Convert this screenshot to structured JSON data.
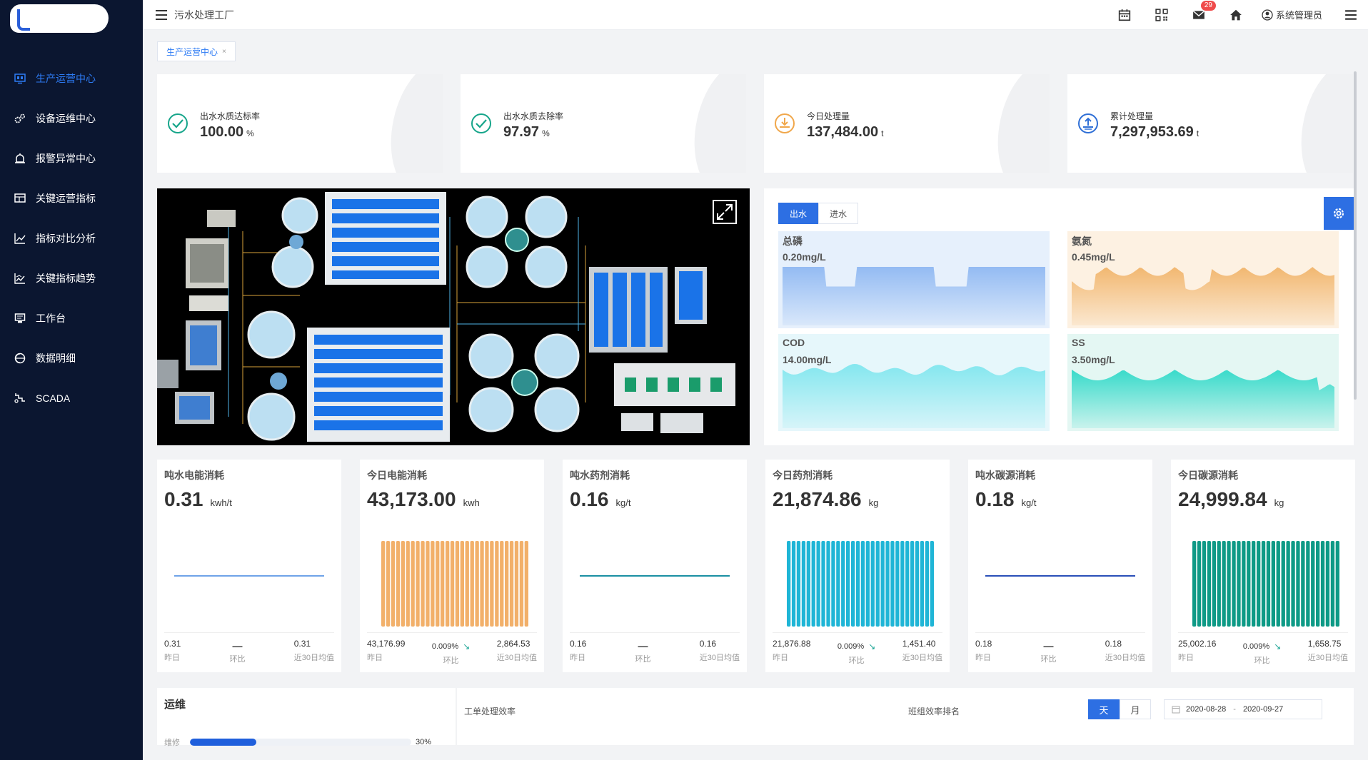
{
  "sidebar": {
    "items": [
      {
        "label": "生产运营中心",
        "icon": "monitor-icon",
        "active": true
      },
      {
        "label": "设备运维中心",
        "icon": "gears-icon",
        "active": false
      },
      {
        "label": "报警异常中心",
        "icon": "alarm-icon",
        "active": false
      },
      {
        "label": "关键运营指标",
        "icon": "dashboard-icon",
        "active": false
      },
      {
        "label": "指标对比分析",
        "icon": "line-chart-icon",
        "active": false
      },
      {
        "label": "关键指标趋势",
        "icon": "trend-icon",
        "active": false
      },
      {
        "label": "工作台",
        "icon": "desktop-icon",
        "active": false
      },
      {
        "label": "数据明细",
        "icon": "database-icon",
        "active": false
      },
      {
        "label": "SCADA",
        "icon": "scada-icon",
        "active": false
      }
    ]
  },
  "header": {
    "breadcrumb": "污水处理工厂",
    "mail_badge": "29",
    "user": "系统管理员"
  },
  "tags": {
    "active_tag": "生产运营中心",
    "close": "×"
  },
  "stats": [
    {
      "label": "出水水质达标率",
      "value": "100.00",
      "unit": "%",
      "icon": "check-circle-icon"
    },
    {
      "label": "出水水质去除率",
      "value": "97.97",
      "unit": "%",
      "icon": "check-circle-icon"
    },
    {
      "label": "今日处理量",
      "value": "137,484.00",
      "unit": "t",
      "icon": "download-circle-icon"
    },
    {
      "label": "累计处理量",
      "value": "7,297,953.69",
      "unit": "t",
      "icon": "upload-circle-icon"
    }
  ],
  "quality": {
    "tabs": [
      "出水",
      "进水"
    ],
    "active_tab": "出水",
    "cards": [
      {
        "name": "总磷",
        "value": "0.20mg/L",
        "color": "#8fb8f2",
        "bg": "#e6f0fc"
      },
      {
        "name": "氨氮",
        "value": "0.45mg/L",
        "color": "#f1b46a",
        "bg": "#fdf1e2"
      },
      {
        "name": "COD",
        "value": "14.00mg/L",
        "color": "#7fe6ee",
        "bg": "#e6f7fb"
      },
      {
        "name": "SS",
        "value": "3.50mg/L",
        "color": "#2fd9c8",
        "bg": "#e4f7f3"
      }
    ]
  },
  "consumption": [
    {
      "title": "吨水电能消耗",
      "value": "0.31",
      "unit": "kwh/t",
      "yesterday": "0.31",
      "yesterday_label": "昨日",
      "ratio": "—",
      "ratio_label": "环比",
      "avg": "0.31",
      "avg_label": "近30日均值",
      "chart": "line",
      "color": "#6fa3e8"
    },
    {
      "title": "今日电能消耗",
      "value": "43,173.00",
      "unit": "kwh",
      "yesterday": "43,176.99",
      "yesterday_label": "昨日",
      "ratio": "0.009%",
      "ratio_label": "环比",
      "avg": "2,864.53",
      "avg_label": "近30日均值",
      "chart": "bar",
      "color": "#f2b06a"
    },
    {
      "title": "吨水药剂消耗",
      "value": "0.16",
      "unit": "kg/t",
      "yesterday": "0.16",
      "yesterday_label": "昨日",
      "ratio": "—",
      "ratio_label": "环比",
      "avg": "0.16",
      "avg_label": "近30日均值",
      "chart": "line",
      "color": "#1a8fa3"
    },
    {
      "title": "今日药剂消耗",
      "value": "21,874.86",
      "unit": "kg",
      "yesterday": "21,876.88",
      "yesterday_label": "昨日",
      "ratio": "0.009%",
      "ratio_label": "环比",
      "avg": "1,451.40",
      "avg_label": "近30日均值",
      "chart": "bar",
      "color": "#1fb5d6"
    },
    {
      "title": "吨水碳源消耗",
      "value": "0.18",
      "unit": "kg/t",
      "yesterday": "0.18",
      "yesterday_label": "昨日",
      "ratio": "—",
      "ratio_label": "环比",
      "avg": "0.18",
      "avg_label": "近30日均值",
      "chart": "line",
      "color": "#2a4fb8"
    },
    {
      "title": "今日碳源消耗",
      "value": "24,999.84",
      "unit": "kg",
      "yesterday": "25,002.16",
      "yesterday_label": "昨日",
      "ratio": "0.009%",
      "ratio_label": "环比",
      "avg": "1,658.75",
      "avg_label": "近30日均值",
      "chart": "bar",
      "color": "#0e9a86"
    }
  ],
  "ops": {
    "title": "运维",
    "row_label": "维修",
    "progress": 0.3,
    "progress_text": "30%"
  },
  "efficiency": {
    "title": "工单处理效率",
    "rank_title": "班组效率排名",
    "tabs": [
      "天",
      "月"
    ],
    "active_tab": "天",
    "date_start": "2020-08-28",
    "date_sep": "-",
    "date_end": "2020-09-27"
  }
}
